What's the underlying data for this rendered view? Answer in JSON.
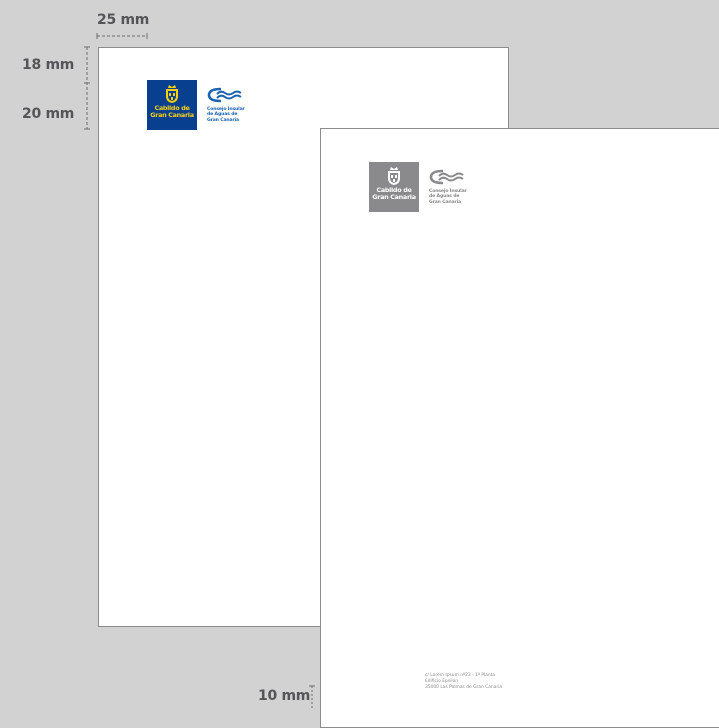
{
  "measurements": {
    "top_width": "25 mm",
    "top_margin": "18 mm",
    "logo_height": "20 mm",
    "bottom_margin": "10 mm"
  },
  "front_sheet": {
    "colors": {
      "block": "#083f8f",
      "text": "#f6cf12",
      "wave": "#1a64b0"
    },
    "cabildo": {
      "line1": "Cabildo de",
      "line2": "Gran Canaria"
    },
    "consejo": {
      "line1": "Consejo Insular",
      "line2": "de Aguas de",
      "line3": "Gran Canaria"
    }
  },
  "back_sheet": {
    "colors": {
      "block": "#8a8a8c",
      "text": "#ffffff",
      "wave": "#8a8a8c"
    },
    "cabildo": {
      "line1": "Cabildo de",
      "line2": "Gran Canaria"
    },
    "consejo": {
      "line1": "Consejo Insular",
      "line2": "de Aguas de",
      "line3": "Gran Canaria"
    },
    "address": {
      "line1": "c/ Lorem Ipsum nº23 - 1ª Planta",
      "line2": "Edificio Epsilon",
      "line3": "35000 Las Palmas de Gran Canaria"
    }
  }
}
